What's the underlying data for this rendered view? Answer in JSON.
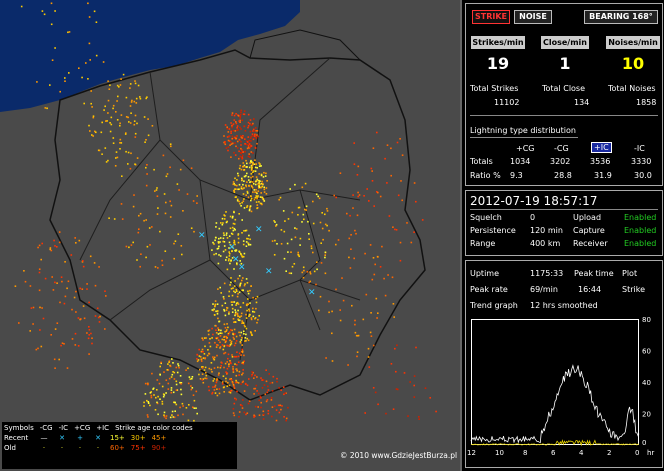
{
  "header": {
    "strike_label": "STRIKE",
    "noise_label": "NOISE",
    "bearing_label": "BEARING 168°"
  },
  "rates": {
    "strikes_label": "Strikes/min",
    "close_label": "Close/min",
    "noises_label": "Noises/min",
    "strikes_value": "19",
    "close_value": "1",
    "noises_value": "10"
  },
  "totals": {
    "strikes_label": "Total Strikes",
    "close_label": "Total Close",
    "noises_label": "Total Noises",
    "strikes_value": "11102",
    "close_value": "134",
    "noises_value": "1858"
  },
  "distribution": {
    "title": "Lightning type distribution",
    "headers": [
      "+CG",
      "-CG",
      "+IC",
      "-IC"
    ],
    "totals_label": "Totals",
    "totals": [
      "1034",
      "3202",
      "3536",
      "3330"
    ],
    "ratio_label": "Ratio %",
    "ratio": [
      "9.3",
      "28.8",
      "31.9",
      "30.0"
    ]
  },
  "status": {
    "datetime": "2012-07-19 18:57:17",
    "squelch_label": "Squelch",
    "squelch_value": "0",
    "upload_label": "Upload",
    "upload_value": "Enabled",
    "persistence_label": "Persistence",
    "persistence_value": "120 min",
    "capture_label": "Capture",
    "capture_value": "Enabled",
    "range_label": "Range",
    "range_value": "400 km",
    "receiver_label": "Receiver",
    "receiver_value": "Enabled"
  },
  "stats": {
    "uptime_label": "Uptime",
    "uptime_value": "1175:33",
    "peak_time_label": "Peak time",
    "plot_label": "Plot",
    "peak_rate_label": "Peak rate",
    "peak_rate_value": "69/min",
    "peak_time_value": "16:44",
    "strike_label": "Strike",
    "trend_label": "Trend graph",
    "trend_value": "12 hrs smoothed"
  },
  "graph": {
    "y_ticks": [
      "80",
      "60",
      "40",
      "20",
      "0"
    ],
    "x_ticks": [
      "12",
      "10",
      "8",
      "6",
      "4",
      "2",
      "0"
    ],
    "x_unit": "hr",
    "colors": {
      "line": "#ffffff",
      "secondary": "#e6d200"
    }
  },
  "legend": {
    "symbols_label": "Symbols",
    "sym_headers": [
      "-CG",
      "-IC",
      "+CG",
      "+IC"
    ],
    "age_label": "Strike age color codes",
    "recent_label": "Recent",
    "old_label": "Old",
    "recent_ages": [
      "15+",
      "30+",
      "45+"
    ],
    "old_ages": [
      "60+",
      "75+",
      "90+"
    ],
    "age_colors": [
      "#ffff33",
      "#ffcc00",
      "#ff9900",
      "#ff6600",
      "#ff3300",
      "#cc2200"
    ]
  },
  "map": {
    "copyright": "© 2010 www.GdzieJestBurza.pl",
    "colors": {
      "land": "#4a4a4a",
      "sea": "#0a2a6a",
      "border": "#111111"
    }
  }
}
